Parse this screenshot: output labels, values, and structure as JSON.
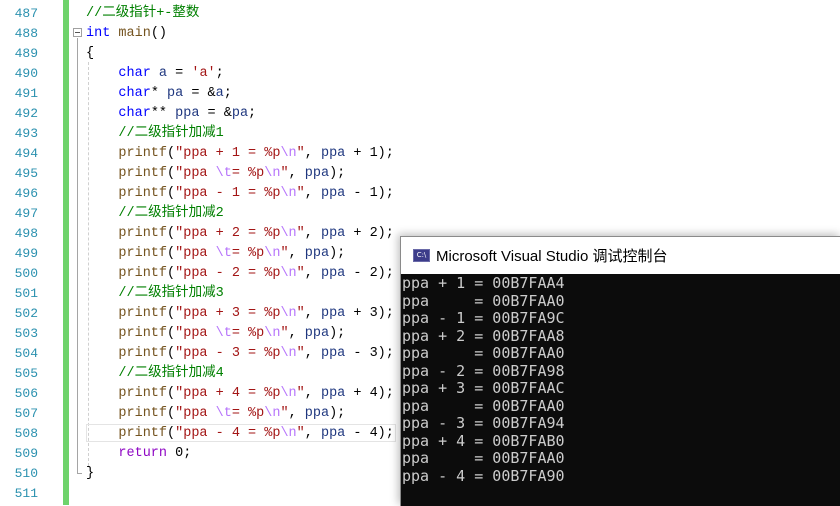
{
  "editor": {
    "line_numbers": [
      "487",
      "488",
      "489",
      "490",
      "491",
      "492",
      "493",
      "494",
      "495",
      "496",
      "497",
      "498",
      "499",
      "500",
      "501",
      "502",
      "503",
      "504",
      "505",
      "506",
      "507",
      "508",
      "509",
      "510",
      "511"
    ],
    "lines": [
      {
        "indent": "",
        "tokens": [
          {
            "t": "//二级指针+-整数",
            "c": "cmt"
          }
        ]
      },
      {
        "indent": "",
        "tokens": [
          {
            "t": "int",
            "c": "kw"
          },
          {
            "t": " ",
            "c": ""
          },
          {
            "t": "main",
            "c": "fn"
          },
          {
            "t": "()",
            "c": ""
          }
        ]
      },
      {
        "indent": "",
        "tokens": [
          {
            "t": "{",
            "c": ""
          }
        ]
      },
      {
        "indent": "    ",
        "tokens": [
          {
            "t": "char",
            "c": "kw"
          },
          {
            "t": " ",
            "c": ""
          },
          {
            "t": "a",
            "c": "var"
          },
          {
            "t": " = ",
            "c": ""
          },
          {
            "t": "'a'",
            "c": "str"
          },
          {
            "t": ";",
            "c": ""
          }
        ]
      },
      {
        "indent": "    ",
        "tokens": [
          {
            "t": "char",
            "c": "kw"
          },
          {
            "t": "* ",
            "c": ""
          },
          {
            "t": "pa",
            "c": "var"
          },
          {
            "t": " = &",
            "c": ""
          },
          {
            "t": "a",
            "c": "var"
          },
          {
            "t": ";",
            "c": ""
          }
        ]
      },
      {
        "indent": "    ",
        "tokens": [
          {
            "t": "char",
            "c": "kw"
          },
          {
            "t": "** ",
            "c": ""
          },
          {
            "t": "ppa",
            "c": "var"
          },
          {
            "t": " = &",
            "c": ""
          },
          {
            "t": "pa",
            "c": "var"
          },
          {
            "t": ";",
            "c": ""
          }
        ]
      },
      {
        "indent": "    ",
        "tokens": [
          {
            "t": "//二级指针加减1",
            "c": "cmt"
          }
        ]
      },
      {
        "indent": "    ",
        "tokens": [
          {
            "t": "printf",
            "c": "fn"
          },
          {
            "t": "(",
            "c": ""
          },
          {
            "t": "\"ppa + 1 = %p",
            "c": "str"
          },
          {
            "t": "\\n",
            "c": "esc"
          },
          {
            "t": "\"",
            "c": "str"
          },
          {
            "t": ", ",
            "c": ""
          },
          {
            "t": "ppa",
            "c": "var"
          },
          {
            "t": " + 1);",
            "c": ""
          }
        ]
      },
      {
        "indent": "    ",
        "tokens": [
          {
            "t": "printf",
            "c": "fn"
          },
          {
            "t": "(",
            "c": ""
          },
          {
            "t": "\"ppa ",
            "c": "str"
          },
          {
            "t": "\\t",
            "c": "esc"
          },
          {
            "t": "= %p",
            "c": "str"
          },
          {
            "t": "\\n",
            "c": "esc"
          },
          {
            "t": "\"",
            "c": "str"
          },
          {
            "t": ", ",
            "c": ""
          },
          {
            "t": "ppa",
            "c": "var"
          },
          {
            "t": ");",
            "c": ""
          }
        ]
      },
      {
        "indent": "    ",
        "tokens": [
          {
            "t": "printf",
            "c": "fn"
          },
          {
            "t": "(",
            "c": ""
          },
          {
            "t": "\"ppa - 1 = %p",
            "c": "str"
          },
          {
            "t": "\\n",
            "c": "esc"
          },
          {
            "t": "\"",
            "c": "str"
          },
          {
            "t": ", ",
            "c": ""
          },
          {
            "t": "ppa",
            "c": "var"
          },
          {
            "t": " - 1);",
            "c": ""
          }
        ]
      },
      {
        "indent": "    ",
        "tokens": [
          {
            "t": "//二级指针加减2",
            "c": "cmt"
          }
        ]
      },
      {
        "indent": "    ",
        "tokens": [
          {
            "t": "printf",
            "c": "fn"
          },
          {
            "t": "(",
            "c": ""
          },
          {
            "t": "\"ppa + 2 = %p",
            "c": "str"
          },
          {
            "t": "\\n",
            "c": "esc"
          },
          {
            "t": "\"",
            "c": "str"
          },
          {
            "t": ", ",
            "c": ""
          },
          {
            "t": "ppa",
            "c": "var"
          },
          {
            "t": " + 2);",
            "c": ""
          }
        ]
      },
      {
        "indent": "    ",
        "tokens": [
          {
            "t": "printf",
            "c": "fn"
          },
          {
            "t": "(",
            "c": ""
          },
          {
            "t": "\"ppa ",
            "c": "str"
          },
          {
            "t": "\\t",
            "c": "esc"
          },
          {
            "t": "= %p",
            "c": "str"
          },
          {
            "t": "\\n",
            "c": "esc"
          },
          {
            "t": "\"",
            "c": "str"
          },
          {
            "t": ", ",
            "c": ""
          },
          {
            "t": "ppa",
            "c": "var"
          },
          {
            "t": ");",
            "c": ""
          }
        ]
      },
      {
        "indent": "    ",
        "tokens": [
          {
            "t": "printf",
            "c": "fn"
          },
          {
            "t": "(",
            "c": ""
          },
          {
            "t": "\"ppa - 2 = %p",
            "c": "str"
          },
          {
            "t": "\\n",
            "c": "esc"
          },
          {
            "t": "\"",
            "c": "str"
          },
          {
            "t": ", ",
            "c": ""
          },
          {
            "t": "ppa",
            "c": "var"
          },
          {
            "t": " - 2);",
            "c": ""
          }
        ]
      },
      {
        "indent": "    ",
        "tokens": [
          {
            "t": "//二级指针加减3",
            "c": "cmt"
          }
        ]
      },
      {
        "indent": "    ",
        "tokens": [
          {
            "t": "printf",
            "c": "fn"
          },
          {
            "t": "(",
            "c": ""
          },
          {
            "t": "\"ppa + 3 = %p",
            "c": "str"
          },
          {
            "t": "\\n",
            "c": "esc"
          },
          {
            "t": "\"",
            "c": "str"
          },
          {
            "t": ", ",
            "c": ""
          },
          {
            "t": "ppa",
            "c": "var"
          },
          {
            "t": " + 3);",
            "c": ""
          }
        ]
      },
      {
        "indent": "    ",
        "tokens": [
          {
            "t": "printf",
            "c": "fn"
          },
          {
            "t": "(",
            "c": ""
          },
          {
            "t": "\"ppa ",
            "c": "str"
          },
          {
            "t": "\\t",
            "c": "esc"
          },
          {
            "t": "= %p",
            "c": "str"
          },
          {
            "t": "\\n",
            "c": "esc"
          },
          {
            "t": "\"",
            "c": "str"
          },
          {
            "t": ", ",
            "c": ""
          },
          {
            "t": "ppa",
            "c": "var"
          },
          {
            "t": ");",
            "c": ""
          }
        ]
      },
      {
        "indent": "    ",
        "tokens": [
          {
            "t": "printf",
            "c": "fn"
          },
          {
            "t": "(",
            "c": ""
          },
          {
            "t": "\"ppa - 3 = %p",
            "c": "str"
          },
          {
            "t": "\\n",
            "c": "esc"
          },
          {
            "t": "\"",
            "c": "str"
          },
          {
            "t": ", ",
            "c": ""
          },
          {
            "t": "ppa",
            "c": "var"
          },
          {
            "t": " - 3);",
            "c": ""
          }
        ]
      },
      {
        "indent": "    ",
        "tokens": [
          {
            "t": "//二级指针加减4",
            "c": "cmt"
          }
        ]
      },
      {
        "indent": "    ",
        "tokens": [
          {
            "t": "printf",
            "c": "fn"
          },
          {
            "t": "(",
            "c": ""
          },
          {
            "t": "\"ppa + 4 = %p",
            "c": "str"
          },
          {
            "t": "\\n",
            "c": "esc"
          },
          {
            "t": "\"",
            "c": "str"
          },
          {
            "t": ", ",
            "c": ""
          },
          {
            "t": "ppa",
            "c": "var"
          },
          {
            "t": " + 4);",
            "c": ""
          }
        ]
      },
      {
        "indent": "    ",
        "tokens": [
          {
            "t": "printf",
            "c": "fn"
          },
          {
            "t": "(",
            "c": ""
          },
          {
            "t": "\"ppa ",
            "c": "str"
          },
          {
            "t": "\\t",
            "c": "esc"
          },
          {
            "t": "= %p",
            "c": "str"
          },
          {
            "t": "\\n",
            "c": "esc"
          },
          {
            "t": "\"",
            "c": "str"
          },
          {
            "t": ", ",
            "c": ""
          },
          {
            "t": "ppa",
            "c": "var"
          },
          {
            "t": ");",
            "c": ""
          }
        ]
      },
      {
        "indent": "    ",
        "tokens": [
          {
            "t": "printf",
            "c": "fn"
          },
          {
            "t": "(",
            "c": ""
          },
          {
            "t": "\"ppa - 4 = %p",
            "c": "str"
          },
          {
            "t": "\\n",
            "c": "esc"
          },
          {
            "t": "\"",
            "c": "str"
          },
          {
            "t": ", ",
            "c": ""
          },
          {
            "t": "ppa",
            "c": "var"
          },
          {
            "t": " - 4);",
            "c": ""
          }
        ]
      },
      {
        "indent": "    ",
        "tokens": [
          {
            "t": "return",
            "c": "ret"
          },
          {
            "t": " 0;",
            "c": ""
          }
        ]
      },
      {
        "indent": "",
        "tokens": [
          {
            "t": "}",
            "c": ""
          }
        ]
      },
      {
        "indent": "",
        "tokens": []
      }
    ]
  },
  "console": {
    "icon_label": "C:\\",
    "title": "Microsoft Visual Studio 调试控制台",
    "output": [
      "ppa + 1 = 00B7FAA4",
      "ppa     = 00B7FAA0",
      "ppa - 1 = 00B7FA9C",
      "ppa + 2 = 00B7FAA8",
      "ppa     = 00B7FAA0",
      "ppa - 2 = 00B7FA98",
      "ppa + 3 = 00B7FAAC",
      "ppa     = 00B7FAA0",
      "ppa - 3 = 00B7FA94",
      "ppa + 4 = 00B7FAB0",
      "ppa     = 00B7FAA0",
      "ppa - 4 = 00B7FA90"
    ]
  }
}
